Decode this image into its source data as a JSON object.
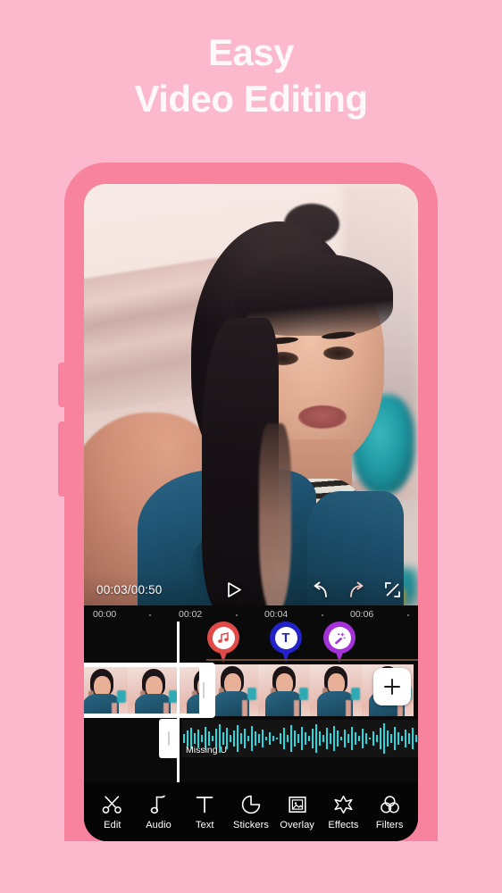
{
  "headline": {
    "line1": "Easy",
    "line2": "Video Editing",
    "color": "#FFF8F9"
  },
  "theme": {
    "background": "#FCB8CC",
    "phone_frame": "#F8839F",
    "screen": "#000000",
    "accent_music": "#E24A4A",
    "accent_text": "#2222C9",
    "accent_effect": "#A432D8",
    "waveform": "#27D9DE"
  },
  "preview": {
    "time_current": "00:03",
    "time_total": "00:50",
    "time_label": "00:03/00:50",
    "controls": [
      {
        "name": "play-icon",
        "label": "Play"
      },
      {
        "name": "undo-icon",
        "label": "Undo"
      },
      {
        "name": "redo-icon",
        "label": "Redo"
      },
      {
        "name": "fullscreen-icon",
        "label": "Fullscreen"
      }
    ]
  },
  "timeline": {
    "ruler_ticks": [
      "00:00",
      "00:02",
      "00:04",
      "00:06"
    ],
    "markers": [
      {
        "name": "music-marker",
        "glyph": "♫",
        "kind": "music",
        "color": "#E24A4A"
      },
      {
        "name": "text-marker",
        "glyph": "T",
        "kind": "text",
        "color": "#2222C9"
      },
      {
        "name": "effect-marker",
        "glyph": "",
        "kind": "effect",
        "color": "#A432D8"
      }
    ],
    "video_track": {
      "name": "video-track",
      "selected_clip_label": "",
      "thumbnail_count": 6,
      "add_button_label": "+"
    },
    "audio_track": {
      "name": "audio-track",
      "clip_title": "Missing U"
    },
    "playhead_time": "00:03"
  },
  "toolbar": [
    {
      "label": "Edit",
      "icon": "scissors-icon"
    },
    {
      "label": "Audio",
      "icon": "music-note-icon"
    },
    {
      "label": "Text",
      "icon": "text-t-icon"
    },
    {
      "label": "Stickers",
      "icon": "sticker-icon"
    },
    {
      "label": "Overlay",
      "icon": "overlay-image-icon"
    },
    {
      "label": "Effects",
      "icon": "magic-star-icon"
    },
    {
      "label": "Filters",
      "icon": "filters-circles-icon"
    }
  ]
}
